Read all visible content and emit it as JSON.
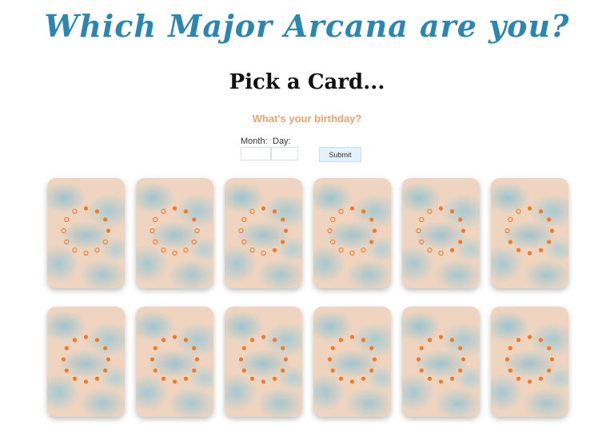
{
  "header": {
    "title": "Which Major Arcana are you?",
    "subtitle": "Pick a Card...",
    "question": "What's your birthday?"
  },
  "form": {
    "month_label": "Month:",
    "day_label": "Day:",
    "month_value": "",
    "day_value": "",
    "submit_label": "Submit"
  },
  "colors": {
    "accent": "#2b87b0",
    "dots": "#f07a2a",
    "question": "#f0a06a",
    "card_base": "#efd5c0",
    "card_blue": "#8cc3d2"
  },
  "cards": {
    "count": 12,
    "rows": 2,
    "per_row": 6,
    "filled_dots_per_card": [
      4,
      3,
      6,
      5,
      6,
      9,
      12,
      12,
      12,
      12,
      12,
      12
    ]
  }
}
